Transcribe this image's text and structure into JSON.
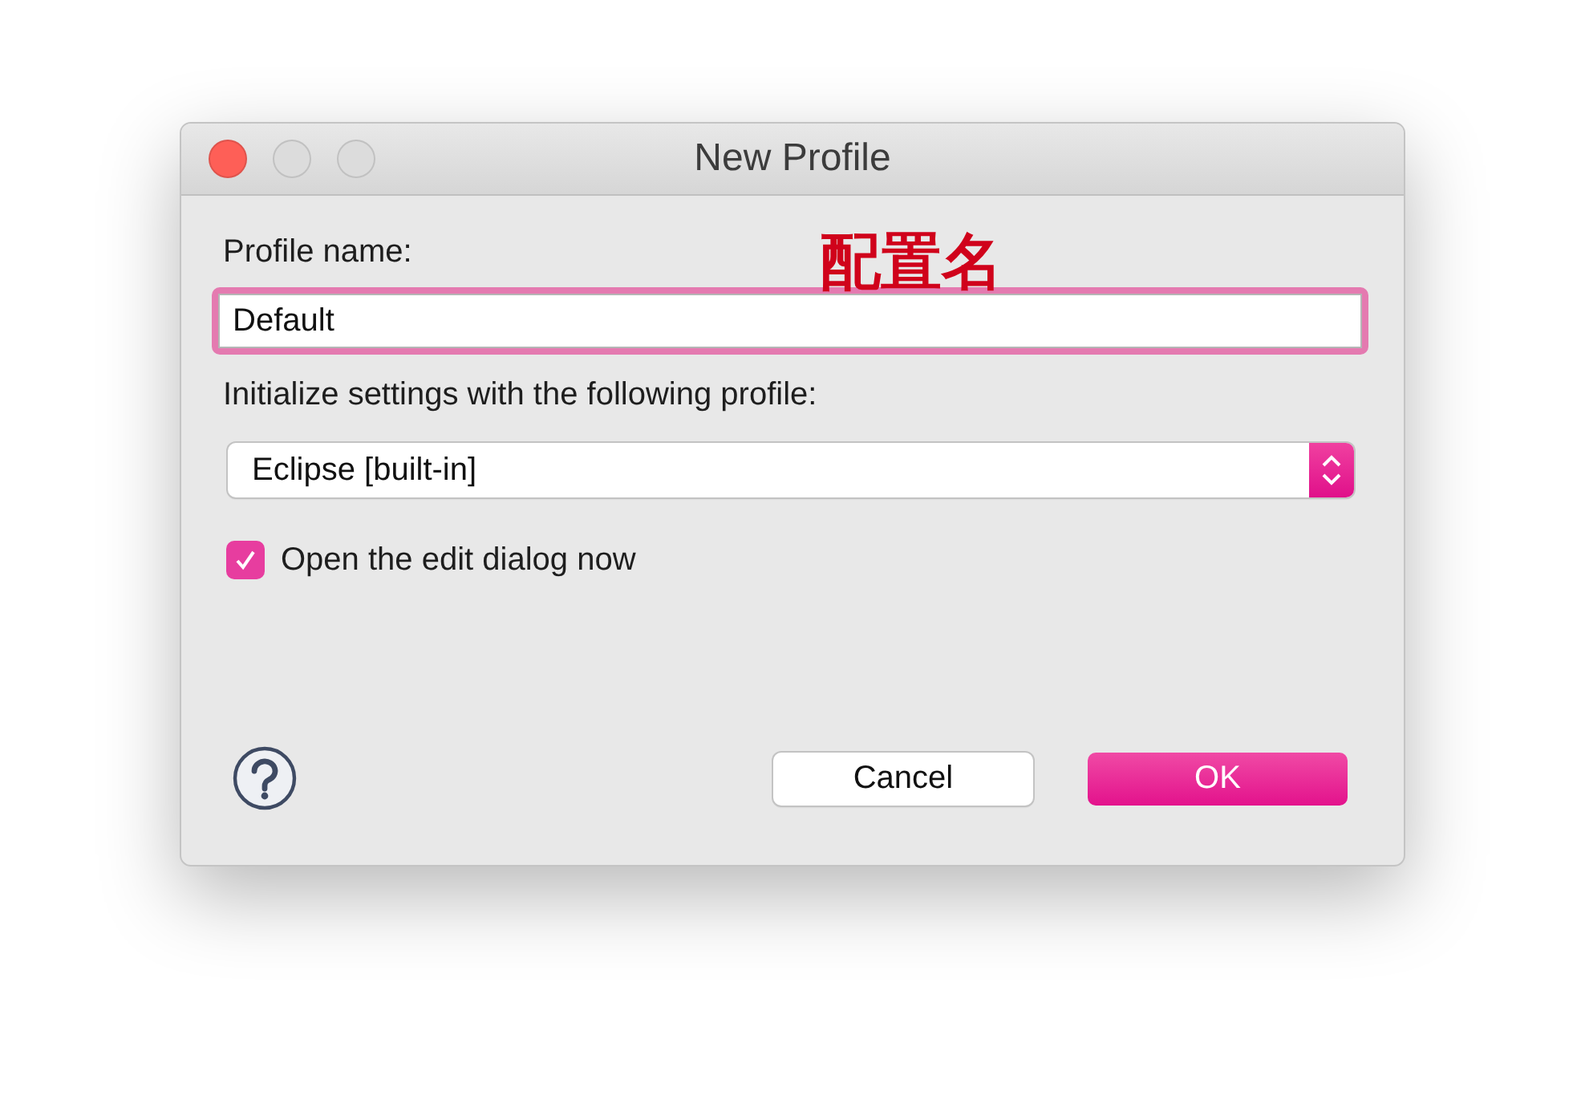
{
  "window": {
    "title": "New Profile",
    "traffic_lights": [
      {
        "color": "#fe5f57"
      },
      {
        "color": "#dcdcdc"
      },
      {
        "color": "#dcdcdc"
      }
    ]
  },
  "profile_name": {
    "label": "Profile name:",
    "value": "Default",
    "focused": true
  },
  "annotation": "配置名",
  "initialize": {
    "label": "Initialize settings with the following profile:",
    "value": "Eclipse [built-in]"
  },
  "open_dialog": {
    "label": "Open the edit dialog now",
    "checked": true
  },
  "buttons": [
    {
      "label": "Cancel",
      "default": false
    },
    {
      "label": "OK",
      "default": true
    }
  ]
}
